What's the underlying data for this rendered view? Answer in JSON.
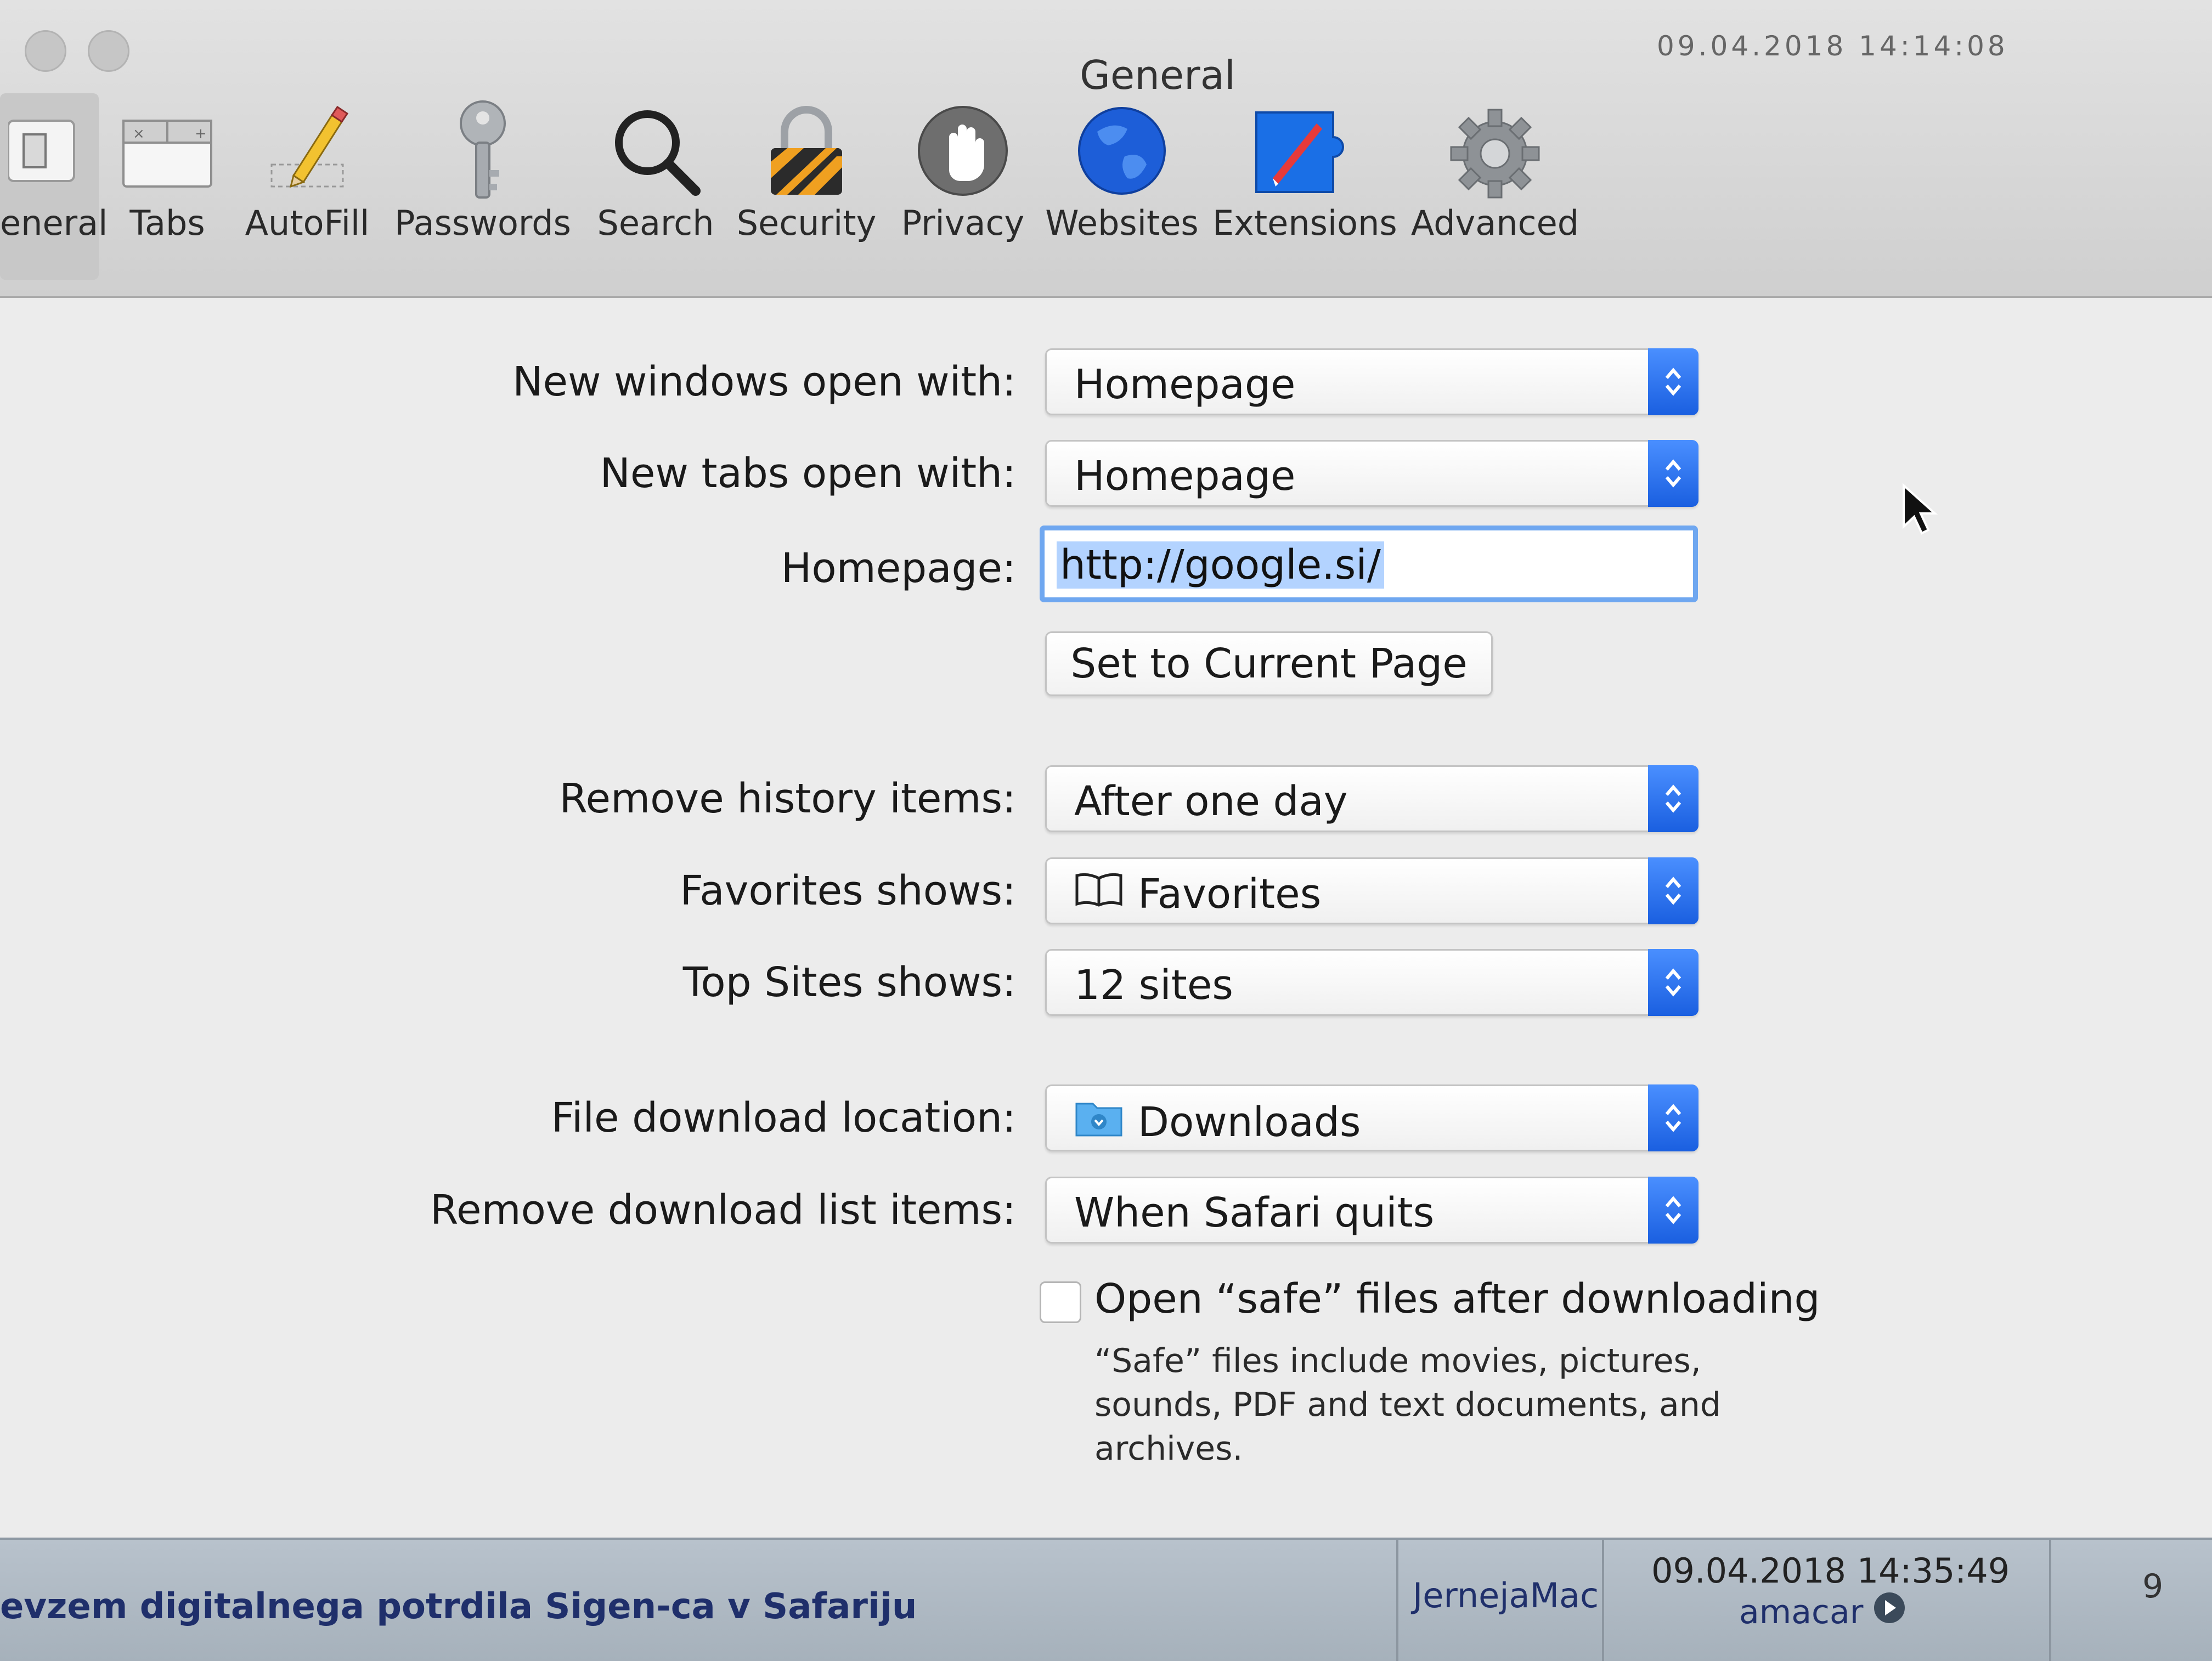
{
  "window": {
    "title": "General",
    "top_date_partial": "09.04.2018 14:14:08"
  },
  "toolbar": {
    "items": [
      {
        "id": "general",
        "label": "eneral",
        "icon": "general-switch-icon"
      },
      {
        "id": "tabs",
        "label": "Tabs",
        "icon": "tabs-icon"
      },
      {
        "id": "autofill",
        "label": "AutoFill",
        "icon": "pencil-icon"
      },
      {
        "id": "passwords",
        "label": "Passwords",
        "icon": "key-icon"
      },
      {
        "id": "search",
        "label": "Search",
        "icon": "magnifier-icon"
      },
      {
        "id": "security",
        "label": "Security",
        "icon": "padlock-icon"
      },
      {
        "id": "privacy",
        "label": "Privacy",
        "icon": "hand-icon"
      },
      {
        "id": "websites",
        "label": "Websites",
        "icon": "globe-icon"
      },
      {
        "id": "extensions",
        "label": "Extensions",
        "icon": "puzzle-compass-icon"
      },
      {
        "id": "advanced",
        "label": "Advanced",
        "icon": "gear-icon"
      }
    ]
  },
  "settings": {
    "new_windows": {
      "label": "New windows open with:",
      "value": "Homepage"
    },
    "new_tabs": {
      "label": "New tabs open with:",
      "value": "Homepage"
    },
    "homepage": {
      "label": "Homepage:",
      "value": "http://google.si/"
    },
    "set_current_page": "Set to Current Page",
    "remove_history": {
      "label": "Remove history items:",
      "value": "After one day"
    },
    "favorites_shows": {
      "label": "Favorites shows:",
      "value": "Favorites",
      "icon": "book-icon"
    },
    "top_sites": {
      "label": "Top Sites shows:",
      "value": "12 sites"
    },
    "download_location": {
      "label": "File download location:",
      "value": "Downloads",
      "icon": "downloads-folder-icon"
    },
    "remove_downloads": {
      "label": "Remove download list items:",
      "value": "When Safari quits"
    },
    "open_safe_files": {
      "label": "Open “safe” files after downloading",
      "checked": false,
      "note": "“Safe” files include movies, pictures, sounds, PDF and text documents, and archives."
    }
  },
  "taskbar": {
    "task_title": "evzem digitalnega potrdila Sigen-ca v Safariju",
    "machine": "JernejaMac",
    "datetime": "09.04.2018 14:35:49",
    "user": "amacar",
    "count": "9"
  },
  "colors": {
    "accent": "#1a5fe0",
    "selection": "#b3d3ff",
    "focus_ring": "#6fa7f0"
  }
}
